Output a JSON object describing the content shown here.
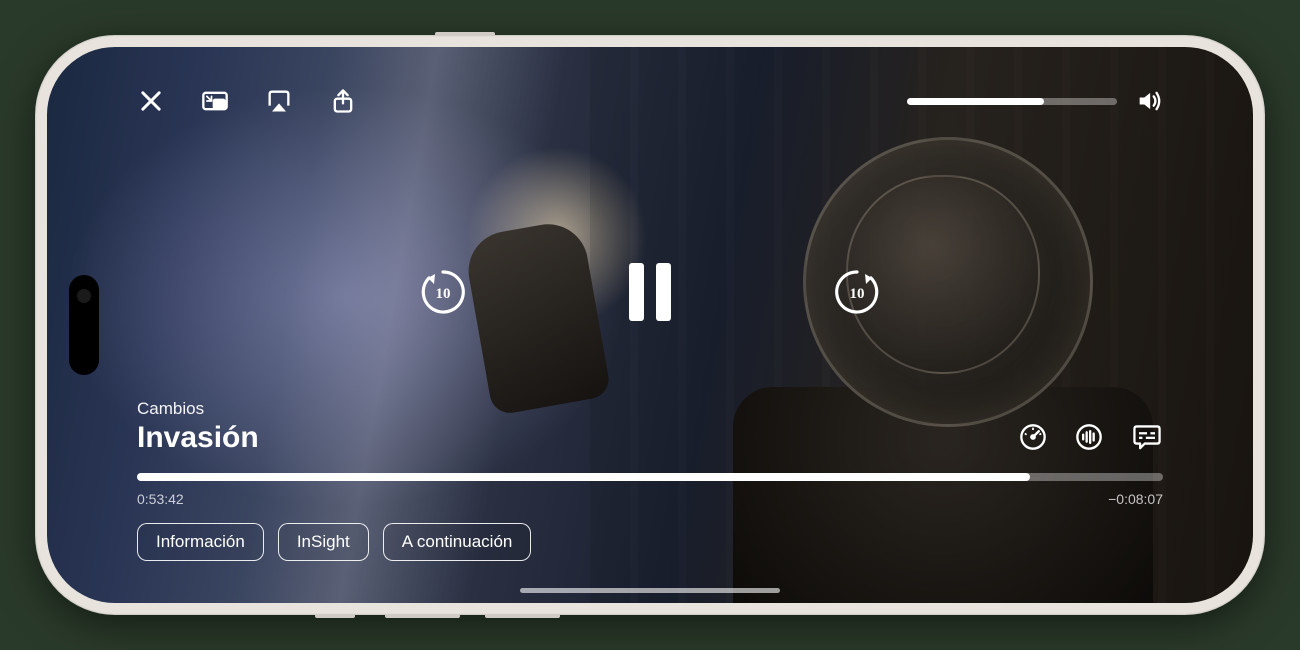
{
  "subtitle": "Cambios",
  "title": "Invasión",
  "elapsed": "0:53:42",
  "remaining": "−0:08:07",
  "progress_percent": 87,
  "volume_percent": 65,
  "skip_seconds": "10",
  "pills": {
    "info": "Información",
    "insight": "InSight",
    "upnext": "A continuación"
  },
  "icons": {
    "close": "close-icon",
    "pip": "pip-icon",
    "airplay": "airplay-icon",
    "share": "share-icon",
    "speaker": "speaker-icon",
    "speed": "speed-icon",
    "audio": "audio-wave-icon",
    "subtitles": "subtitles-icon"
  }
}
